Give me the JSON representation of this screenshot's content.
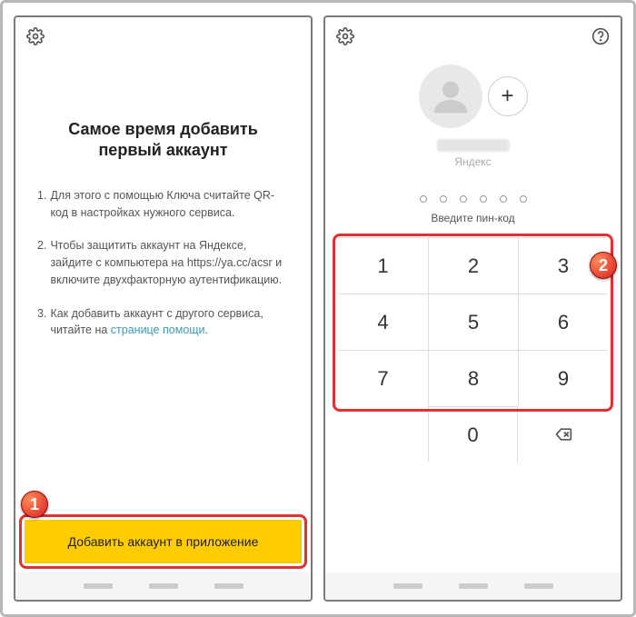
{
  "left": {
    "title": "Самое время добавить первый аккаунт",
    "steps": {
      "s1": "Для этого с помощью Ключа считайте QR-код в настройках нужного сервиса.",
      "s2a": "Чтобы защитить аккаунт на Яндексе, зайдите с компьютера на https://ya.cc/acsr и включите двухфакторную аутентификацию.",
      "s3a": "Как добавить аккаунт с другого сервиса, читайте на ",
      "s3link": "странице помощи",
      "s3b": "."
    },
    "add_button": "Добавить аккаунт в приложение"
  },
  "right": {
    "service": "Яндекс",
    "pin_hint": "Введите пин-код",
    "keys": {
      "k1": "1",
      "k2": "2",
      "k3": "3",
      "k4": "4",
      "k5": "5",
      "k6": "6",
      "k7": "7",
      "k8": "8",
      "k9": "9",
      "k0": "0"
    }
  },
  "badges": {
    "one": "1",
    "two": "2"
  }
}
